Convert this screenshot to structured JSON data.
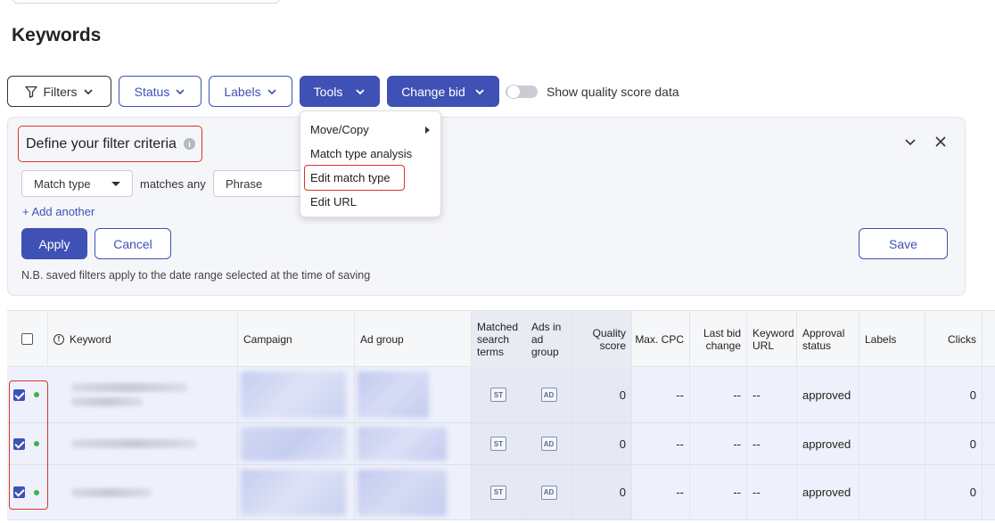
{
  "page": {
    "title": "Keywords"
  },
  "toolbar": {
    "filters_label": "Filters",
    "status_label": "Status",
    "labels_label": "Labels",
    "tools_label": "Tools",
    "change_bid_label": "Change bid",
    "quality_toggle_label": "Show quality score data",
    "quality_toggle_on": false
  },
  "tools_menu": {
    "items": [
      "Move/Copy",
      "Match type analysis",
      "Edit match type",
      "Edit URL"
    ],
    "highlighted": "Edit match type"
  },
  "filter_panel": {
    "title": "Define your filter criteria",
    "field_select": "Match type",
    "operator_text": "matches any",
    "value_select": "Phrase",
    "add_another": "+ Add another",
    "apply_label": "Apply",
    "cancel_label": "Cancel",
    "save_label": "Save",
    "note": "N.B. saved filters apply to the date range selected at the time of saving"
  },
  "table": {
    "headers": {
      "keyword": "Keyword",
      "campaign": "Campaign",
      "ad_group": "Ad group",
      "matched_search_terms": "Matched search terms",
      "ads_in_ad_group": "Ads in ad group",
      "quality_score": "Quality score",
      "max_cpc": "Max. CPC",
      "last_bid_change": "Last bid change",
      "keyword_url": "Keyword URL",
      "approval_status": "Approval status",
      "labels": "Labels",
      "clicks": "Clicks"
    },
    "badge_st": "ST",
    "badge_ad": "AD",
    "rows": [
      {
        "checked": true,
        "quality_score": "0",
        "max_cpc": "--",
        "last_bid_change": "--",
        "keyword_url": "--",
        "approval_status": "approved",
        "clicks": "0"
      },
      {
        "checked": true,
        "quality_score": "0",
        "max_cpc": "--",
        "last_bid_change": "--",
        "keyword_url": "--",
        "approval_status": "approved",
        "clicks": "0"
      },
      {
        "checked": true,
        "quality_score": "0",
        "max_cpc": "--",
        "last_bid_change": "--",
        "keyword_url": "--",
        "approval_status": "approved",
        "clicks": "0"
      }
    ]
  },
  "colors": {
    "accent": "#3f51b5",
    "highlight": "#d9342b",
    "status_dot": "#3bb34a"
  }
}
